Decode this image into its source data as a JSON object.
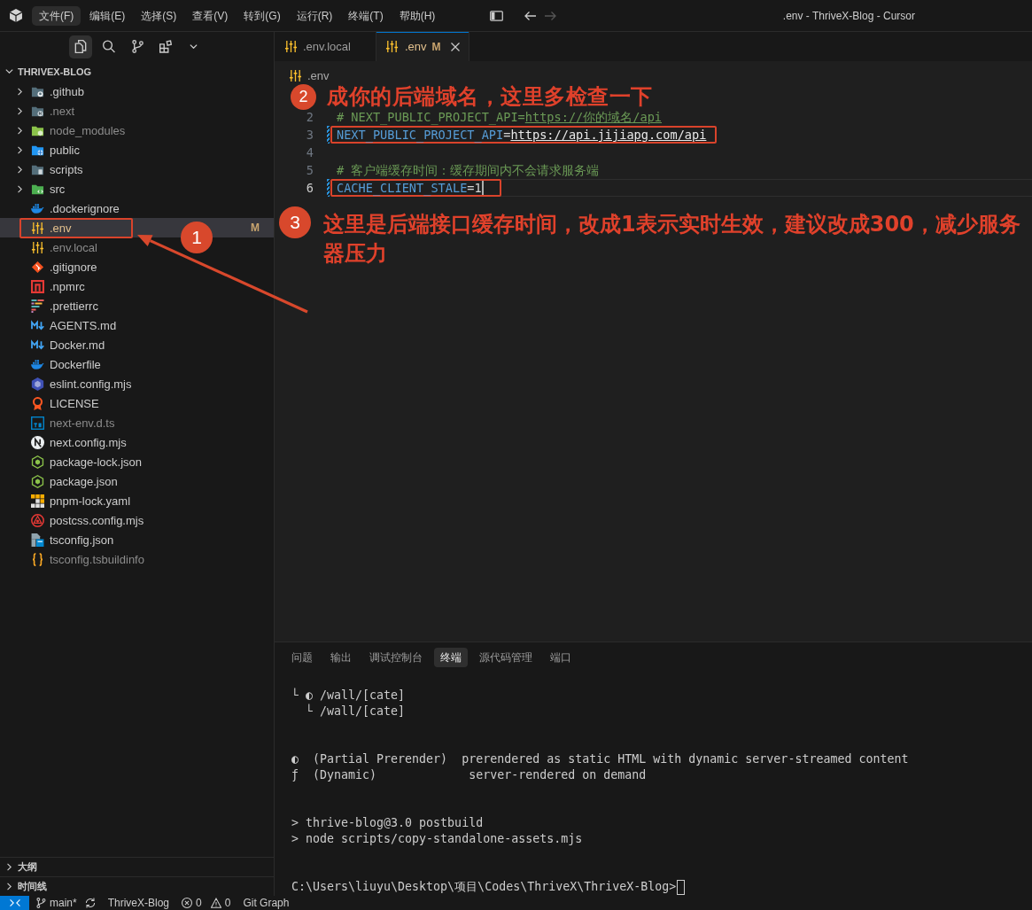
{
  "titlebar": {
    "menu": [
      {
        "label": "文件(F)",
        "selected": true
      },
      {
        "label": "编辑(E)",
        "selected": false
      },
      {
        "label": "选择(S)",
        "selected": false
      },
      {
        "label": "查看(V)",
        "selected": false
      },
      {
        "label": "转到(G)",
        "selected": false
      },
      {
        "label": "运行(R)",
        "selected": false
      },
      {
        "label": "终端(T)",
        "selected": false
      },
      {
        "label": "帮助(H)",
        "selected": false
      }
    ],
    "controls": [
      {
        "kind": "layout",
        "disabled": false
      },
      {
        "kind": "back",
        "disabled": false
      },
      {
        "kind": "forward",
        "disabled": true
      }
    ],
    "title": ".env - ThriveX-Blog - Cursor"
  },
  "sidebar": {
    "views": [
      {
        "kind": "explorer",
        "selected": true
      },
      {
        "kind": "search",
        "selected": false
      },
      {
        "kind": "scm",
        "selected": false
      },
      {
        "kind": "extensions",
        "selected": false
      },
      {
        "kind": "more",
        "selected": false
      }
    ],
    "explorer": {
      "title": "THRIVEX-BLOG",
      "expanded": true,
      "items": [
        {
          "label": ".github",
          "kind": "gitfolder",
          "expanded": false,
          "dimmed": false,
          "selected": false
        },
        {
          "label": ".next",
          "kind": "nextfolder",
          "expanded": false,
          "dimmed": true,
          "selected": false
        },
        {
          "label": "node_modules",
          "kind": "nodefolder",
          "expanded": false,
          "dimmed": true,
          "selected": false
        },
        {
          "label": "public",
          "kind": "webfolder",
          "expanded": false,
          "dimmed": false,
          "selected": false
        },
        {
          "label": "scripts",
          "kind": "scriptsfolder",
          "expanded": false,
          "dimmed": false,
          "selected": false
        },
        {
          "label": "src",
          "kind": "srcfolder",
          "expanded": false,
          "dimmed": false,
          "selected": false
        },
        {
          "label": ".dockerignore",
          "kind": "docker",
          "dimmed": false,
          "selected": false
        },
        {
          "label": ".env",
          "kind": "env",
          "badge": "M",
          "dimmed": false,
          "selected": true
        },
        {
          "label": ".env.local",
          "kind": "env",
          "dimmed": true,
          "selected": false
        },
        {
          "label": ".gitignore",
          "kind": "git",
          "dimmed": false,
          "selected": false
        },
        {
          "label": ".npmrc",
          "kind": "npm",
          "dimmed": false,
          "selected": false
        },
        {
          "label": ".prettierrc",
          "kind": "prettier",
          "dimmed": false,
          "selected": false
        },
        {
          "label": "AGENTS.md",
          "kind": "markdown",
          "dimmed": false,
          "selected": false
        },
        {
          "label": "Docker.md",
          "kind": "markdown",
          "dimmed": false,
          "selected": false
        },
        {
          "label": "Dockerfile",
          "kind": "docker",
          "dimmed": false,
          "selected": false
        },
        {
          "label": "eslint.config.mjs",
          "kind": "eslint",
          "dimmed": false,
          "selected": false
        },
        {
          "label": "LICENSE",
          "kind": "license",
          "dimmed": false,
          "selected": false
        },
        {
          "label": "next-env.d.ts",
          "kind": "typescript",
          "dimmed": true,
          "selected": false
        },
        {
          "label": "next.config.mjs",
          "kind": "nextjs",
          "dimmed": false,
          "selected": false
        },
        {
          "label": "package-lock.json",
          "kind": "nodejs",
          "dimmed": false,
          "selected": false
        },
        {
          "label": "package.json",
          "kind": "nodejs",
          "dimmed": false,
          "selected": false
        },
        {
          "label": "pnpm-lock.yaml",
          "kind": "pnpm",
          "dimmed": false,
          "selected": false
        },
        {
          "label": "postcss.config.mjs",
          "kind": "postcss",
          "dimmed": false,
          "selected": false
        },
        {
          "label": "tsconfig.json",
          "kind": "tsconfig",
          "dimmed": false,
          "selected": false
        },
        {
          "label": "tsconfig.tsbuildinfo",
          "kind": "braces",
          "dimmed": true,
          "selected": false
        }
      ]
    },
    "sections": [
      {
        "title": "大纲",
        "expanded": false
      },
      {
        "title": "时间线",
        "expanded": false
      }
    ]
  },
  "editor": {
    "tabs": [
      {
        "label": ".env.local",
        "kind": "env",
        "selected": false
      },
      {
        "label": ".env",
        "kind": "env",
        "badge": "M",
        "selected": true
      }
    ],
    "breadcrumb": {
      "label": ".env",
      "kind": "env"
    },
    "lines": [
      {
        "number": "2",
        "modified": false,
        "current": false,
        "cursor": false,
        "highlighted": false,
        "tokens": [
          {
            "kind": "comment",
            "text": "# NEXT_PUBLIC_PROJECT_API="
          },
          {
            "kind": "commentlink",
            "text": "https://你的域名/api"
          }
        ]
      },
      {
        "number": "3",
        "modified": true,
        "current": false,
        "cursor": false,
        "highlighted": true,
        "tokens": [
          {
            "kind": "key",
            "text": "NEXT_PUBLIC_PROJECT_API"
          },
          {
            "kind": "op",
            "text": "="
          },
          {
            "kind": "link",
            "text": "https://api.jijiapg.com/api"
          }
        ]
      },
      {
        "number": "4",
        "modified": false,
        "current": false,
        "cursor": false,
        "highlighted": false
      },
      {
        "number": "5",
        "modified": false,
        "current": false,
        "cursor": false,
        "highlighted": false,
        "tokens": [
          {
            "kind": "comment",
            "text": "# 客户端缓存时间：缓存期间内不会请求服务端"
          }
        ]
      },
      {
        "number": "6",
        "modified": true,
        "current": true,
        "cursor": true,
        "highlighted": true,
        "tokens": [
          {
            "kind": "key",
            "text": "CACHE_CLIENT_STALE"
          },
          {
            "kind": "op",
            "text": "="
          },
          {
            "kind": "value",
            "text": "1"
          }
        ]
      }
    ]
  },
  "panel": {
    "tabs": [
      {
        "label": "问题",
        "selected": false
      },
      {
        "label": "输出",
        "selected": false
      },
      {
        "label": "调试控制台",
        "selected": false
      },
      {
        "label": "终端",
        "selected": true
      },
      {
        "label": "源代码管理",
        "selected": false
      },
      {
        "label": "端口",
        "selected": false
      }
    ],
    "terminal": {
      "groups": [
        [
          "└ ◐ /wall/[cate]",
          "  └ /wall/[cate]"
        ],
        [
          "◐  (Partial Prerender)  prerendered as static HTML with dynamic server-streamed content",
          "ƒ  (Dynamic)             server-rendered on demand"
        ],
        [
          "> thrive-blog@3.0 postbuild",
          "> node scripts/copy-standalone-assets.mjs"
        ]
      ],
      "prompt": "C:\\Users\\liuyu\\Desktop\\项目\\Codes\\ThriveX\\ThriveX-Blog>"
    }
  },
  "status_bar": {
    "items": [
      {
        "kind": "remote"
      },
      {
        "kind": "branch",
        "text": "main*"
      },
      {
        "kind": "sync"
      },
      {
        "kind": "text",
        "text": "ThriveX-Blog"
      },
      {
        "kind": "problems",
        "errors": "0",
        "warnings": "0"
      },
      {
        "kind": "text",
        "text": "Git Graph"
      }
    ]
  },
  "annotations": [
    {
      "number": "1",
      "arrow": true
    },
    {
      "number": "2",
      "text": "成你的后端域名，这里多检查一下"
    },
    {
      "number": "3",
      "text": "这里是后端接口缓存时间，改成1表示实时生效，建议改成300，减少服务器压力"
    }
  ]
}
